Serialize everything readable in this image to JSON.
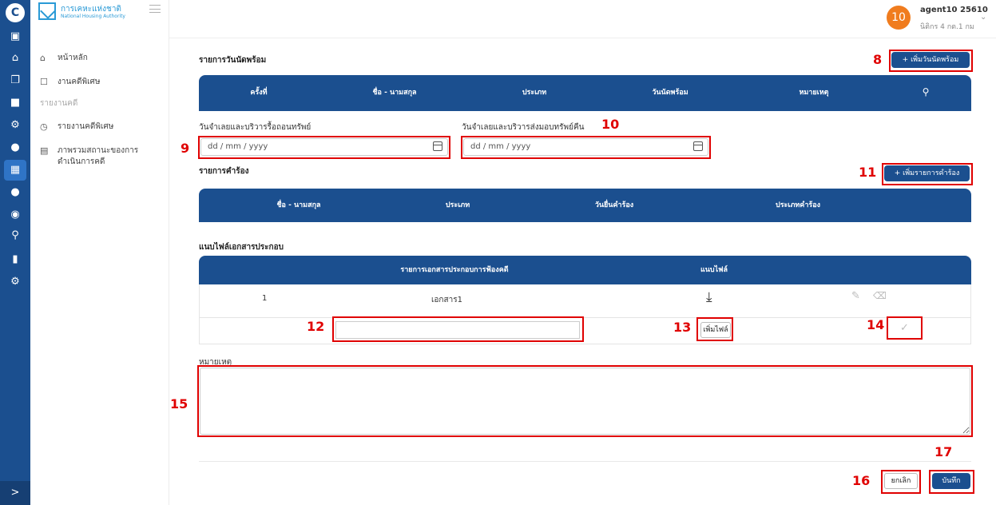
{
  "rail": {
    "logo": "C",
    "icons": [
      "briefcase-icon",
      "home-icon",
      "copy-icon",
      "document-icon",
      "gear-icon",
      "user-icon",
      "dashboard-icon",
      "users-icon",
      "settings-icon",
      "search-icon",
      "chart-icon",
      "cogs-icon"
    ],
    "expand_glyph": ">"
  },
  "brand": {
    "name_th": "การเคหะแห่งชาติ",
    "name_en": "National Housing Authority"
  },
  "sidebar": {
    "items": [
      {
        "label": "หน้าหลัก",
        "icon": "home-outline-icon"
      },
      {
        "label": "งานคดีพิเศษ",
        "icon": "bookmark-icon"
      }
    ],
    "section_label": "รายงานคดี",
    "report_items": [
      {
        "label": "รายงานคดีพิเศษ",
        "icon": "clock-icon"
      },
      {
        "label": "ภาพรวมสถานะของการดำเนินการคดี",
        "icon": "file-icon"
      }
    ]
  },
  "user": {
    "avatar": "10",
    "name": "agent10 25610",
    "role": "นิติกร 4 กต.1 กม"
  },
  "ready_list": {
    "title": "รายการวันนัดพร้อม",
    "add_button": "+ เพิ่มวันนัดพร้อม",
    "columns": [
      "ครั้งที่",
      "ชื่อ - นามสกุล",
      "ประเภท",
      "วันนัดพร้อม",
      "หมายเหตุ"
    ]
  },
  "dates": {
    "label_left": "วันจำเลยและบริวารรื้อถอนทรัพย์",
    "label_right": "วันจำเลยและบริวารส่งมอบทรัพย์คืน",
    "placeholder": "dd / mm / yyyy"
  },
  "petitions": {
    "title": "รายการคำร้อง",
    "add_button": "+ เพิ่มรายการคำร้อง",
    "columns": [
      "ชื่อ - นามสกุล",
      "ประเภท",
      "วันยื่นคำร้อง",
      "ประเภทคำร้อง"
    ]
  },
  "attachments": {
    "title": "แนบไฟล์เอกสารประกอบ",
    "columns": [
      "รายการเอกสารประกอบการฟ้องคดี",
      "แนบไฟล์"
    ],
    "rows": [
      {
        "no": "1",
        "name": "เอกสาร1"
      }
    ],
    "add_file_button": "เพิ่มไฟล์"
  },
  "remark": {
    "label": "หมายเหตุ"
  },
  "actions": {
    "cancel": "ยกเลิก",
    "save": "บันทึก"
  },
  "callouts": [
    "8",
    "9",
    "10",
    "11",
    "12",
    "13",
    "14",
    "15",
    "16",
    "17"
  ],
  "colors": {
    "primary": "#1b4f8f",
    "annotation": "#e00000",
    "avatar": "#f07c1e"
  }
}
